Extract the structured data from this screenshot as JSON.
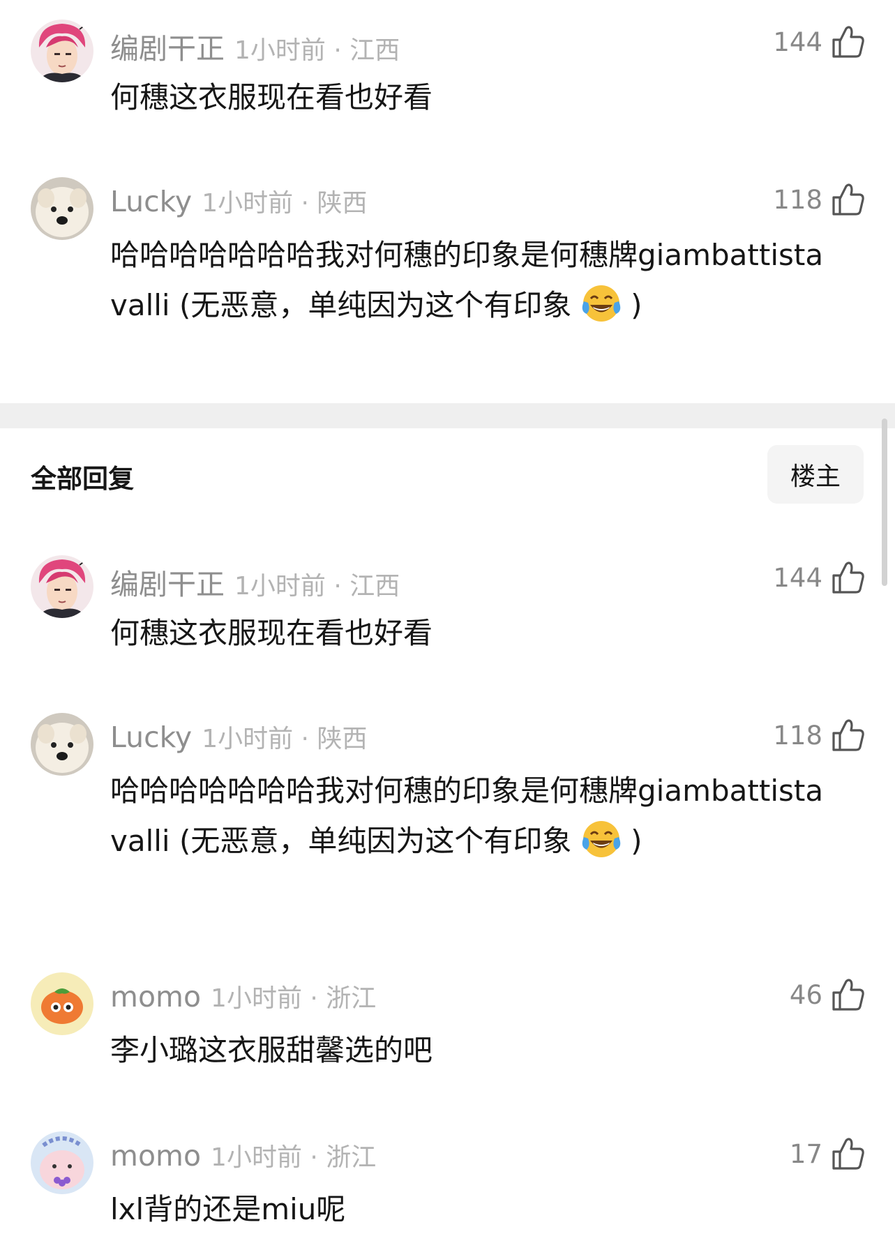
{
  "top_comments": [
    {
      "username": "编剧干正",
      "time_location": "1小时前 · 江西",
      "likes": "144",
      "text": "何穗这衣服现在看也好看",
      "avatar": "anime-pink-hair-avatar"
    },
    {
      "username": "Lucky",
      "time_location": "1小时前 · 陕西",
      "likes": "118",
      "text": "哈哈哈哈哈哈哈我对何穗的印象是何穗牌giambattista valli (无恶意，单纯因为这个有印象",
      "text_tail": ")",
      "avatar": "white-dog-avatar"
    }
  ],
  "section": {
    "title": "全部回复",
    "filter_button": "楼主"
  },
  "replies": [
    {
      "username": "编剧干正",
      "time_location": "1小时前 · 江西",
      "likes": "144",
      "text": "何穗这衣服现在看也好看",
      "avatar": "anime-pink-hair-avatar"
    },
    {
      "username": "Lucky",
      "time_location": "1小时前 · 陕西",
      "likes": "118",
      "text": "哈哈哈哈哈哈哈我对何穗的印象是何穗牌giambattista valli (无恶意，单纯因为这个有印象",
      "text_tail": ")",
      "avatar": "white-dog-avatar"
    },
    {
      "username": "momo",
      "time_location": "1小时前 · 浙江",
      "likes": "46",
      "text": "李小璐这衣服甜馨选的吧",
      "avatar": "persimmon-avatar"
    },
    {
      "username": "momo",
      "time_location": "1小时前 · 浙江",
      "likes": "17",
      "text": "lxl背的还是miu呢",
      "avatar": "pink-bunny-avatar"
    }
  ],
  "icons": {
    "like": "thumbs-up-icon",
    "emoji": "tears-of-joy-emoji"
  },
  "colors": {
    "username": "#8e8e8e",
    "meta": "#b3b3b3",
    "text": "#161616",
    "divider": "#efefef"
  }
}
